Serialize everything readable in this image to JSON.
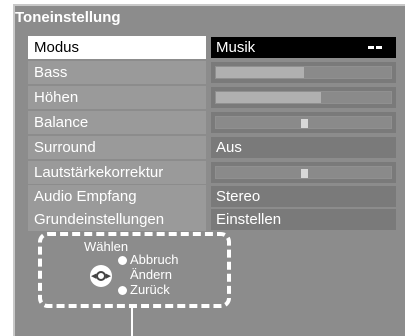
{
  "title": "Toneinstellung",
  "rows": [
    {
      "label": "Modus",
      "value": "Musik"
    },
    {
      "label": "Bass",
      "level": 0.5
    },
    {
      "label": "Höhen",
      "level": 0.6
    },
    {
      "label": "Balance",
      "level": 0.5
    },
    {
      "label": "Surround",
      "value": "Aus"
    },
    {
      "label": "Lautstärkekorrektur",
      "level": 0.5
    },
    {
      "label": "Audio Empfang",
      "value": "Stereo"
    },
    {
      "label": "Grundeinstellungen",
      "value": "Einstellen"
    }
  ],
  "help": {
    "title": "Wählen",
    "items": [
      "Abbruch",
      "Ändern",
      "Zurück"
    ]
  },
  "colors": {
    "panel": "#8c8c8c",
    "selected_label_bg": "#ffffff",
    "selected_value_bg": "#000000",
    "text": "#ffffff"
  },
  "icons": [
    "dpad-icon",
    "selection-indicator-icon",
    "bullet-icon"
  ]
}
